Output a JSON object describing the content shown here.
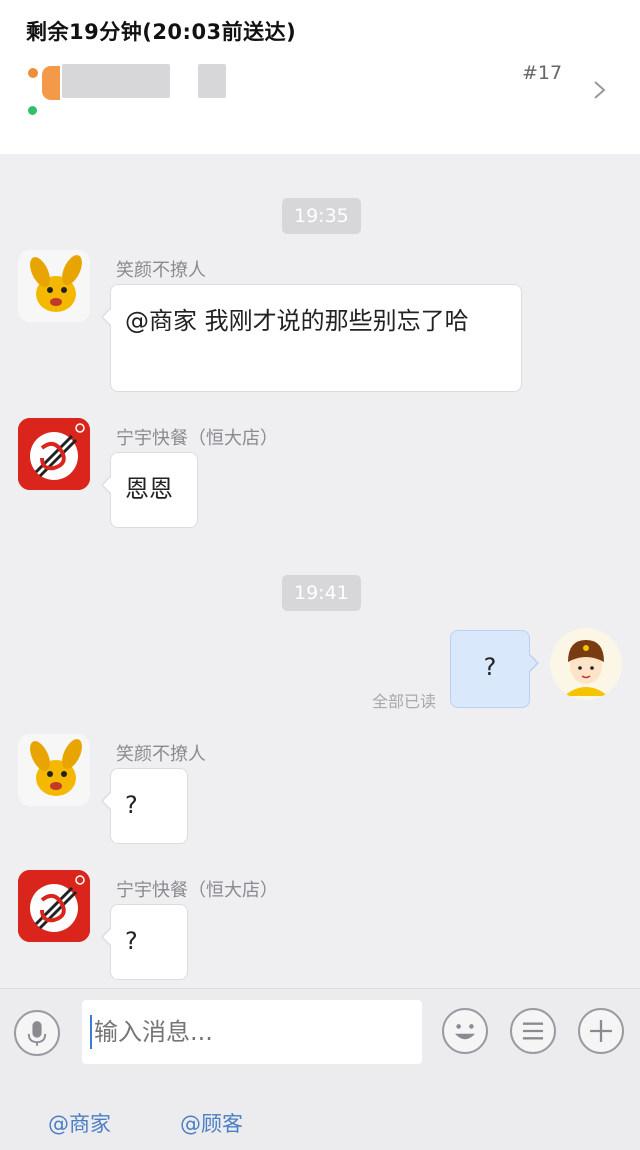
{
  "header": {
    "title": "剩余19分钟(20:03前送达)",
    "order_number": "#17",
    "chevron_icon": "chevron-right-icon"
  },
  "messages": {
    "time1": "19:35",
    "m1_sender": "笑颜不撩人",
    "m1_text": "@商家 我刚才说的那些别忘了哈",
    "m2_sender": "宁宇快餐（恒大店）",
    "m2_text": "恩恩",
    "time2": "19:41",
    "m3_text": "?",
    "m3_status": "全部已读",
    "m4_sender": "笑颜不撩人",
    "m4_text": "?",
    "m5_sender": "宁宇快餐（恒大店）",
    "m5_text": "?"
  },
  "input": {
    "placeholder": "输入消息...",
    "icons": [
      "microphone-icon",
      "emoji-icon",
      "list-icon",
      "plus-icon"
    ]
  },
  "quick_mentions": {
    "merchant": "@商家",
    "customer": "@顾客"
  },
  "colors": {
    "bubble_mine": "#d9e8fb",
    "link": "#4a7fc4",
    "status_green": "#2fc06a",
    "status_orange": "#f08c3a"
  }
}
